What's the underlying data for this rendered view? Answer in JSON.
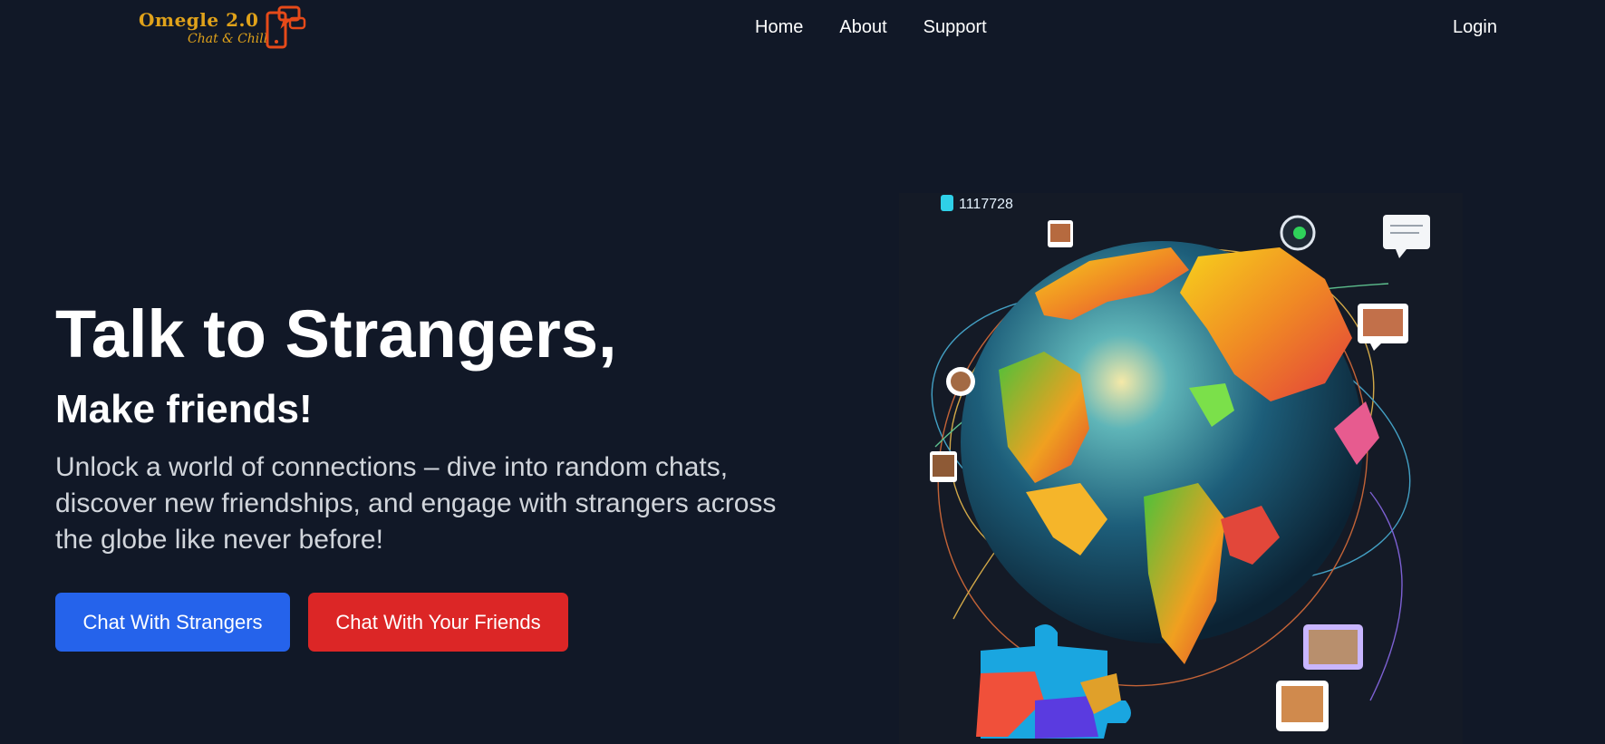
{
  "header": {
    "logo": {
      "title": "Omegle 2.0",
      "subtitle": "Chat & Chill"
    },
    "nav": [
      {
        "label": "Home"
      },
      {
        "label": "About"
      },
      {
        "label": "Support"
      }
    ],
    "login_label": "Login"
  },
  "hero": {
    "title": "Talk to Strangers,",
    "subtitle": "Make friends!",
    "description": "Unlock a world of connections – dive into random chats, discover new friendships, and engage with strangers across the globe like never before!",
    "buttons": {
      "strangers": "Chat With Strangers",
      "friends": "Chat With Your Friends"
    }
  },
  "illustration": {
    "counter": "1117728",
    "icons": [
      "globe-icon",
      "puzzle-icon",
      "chat-bubble-icon",
      "photo-icon",
      "like-icon"
    ]
  },
  "colors": {
    "background": "#111827",
    "primary": "#2563eb",
    "danger": "#dc2626",
    "logo": "#e0a21a",
    "logo_phone": "#e64a19",
    "muted_text": "#d1d5db"
  }
}
